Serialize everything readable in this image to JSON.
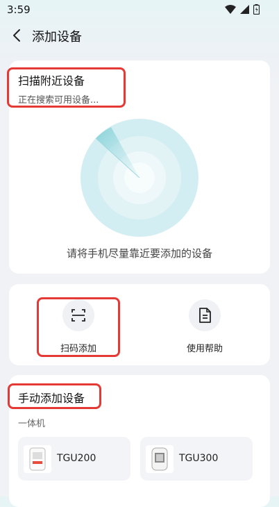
{
  "status_bar": {
    "time": "3:59",
    "icons": [
      "wifi-icon",
      "signal-icon",
      "battery-icon"
    ]
  },
  "nav": {
    "title": "添加设备",
    "back_icon": "chevron-left-icon"
  },
  "scan": {
    "title": "扫描附近设备",
    "subtitle": "正在搜索可用设备...",
    "hint": "请将手机尽量靠近要添加的设备"
  },
  "actions": [
    {
      "label": "扫码添加",
      "icon": "scan-frame-icon"
    },
    {
      "label": "使用帮助",
      "icon": "document-icon"
    }
  ],
  "manual": {
    "title": "手动添加设备",
    "group_label": "一体机",
    "devices": [
      {
        "name": "TGU200",
        "icon": "device-image-icon"
      },
      {
        "name": "TGU300",
        "icon": "device-image-icon"
      }
    ]
  },
  "colors": {
    "highlight": "#e53935",
    "radar": "#bfe6ec",
    "radar_sweep": "#8fd3d9"
  }
}
